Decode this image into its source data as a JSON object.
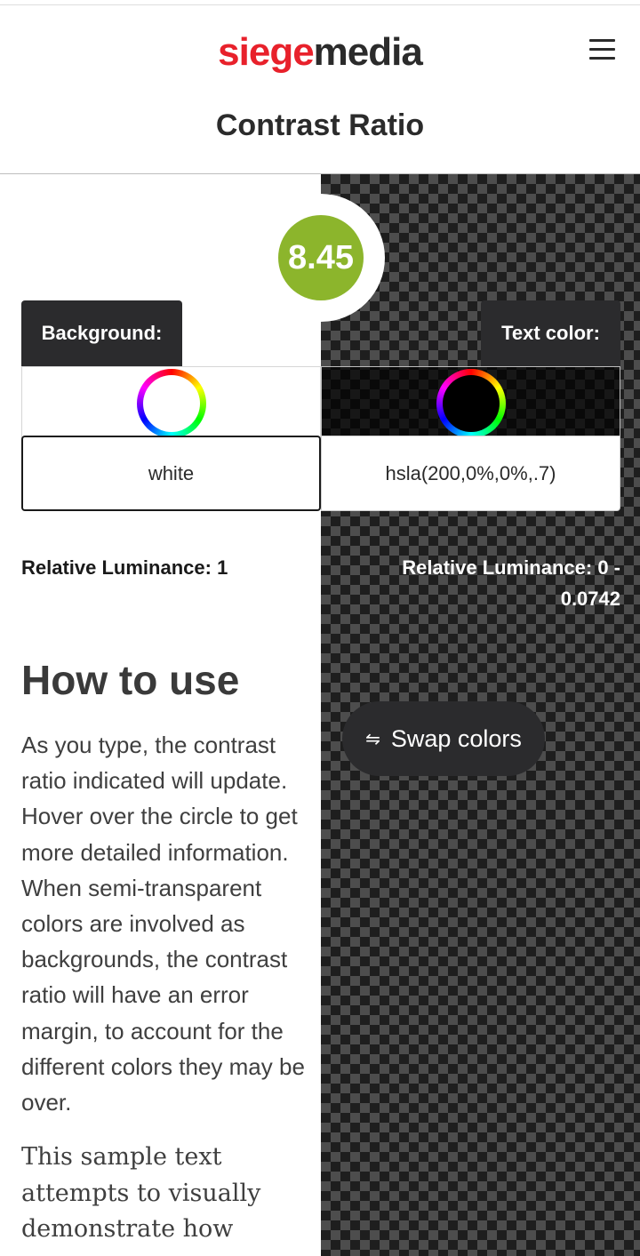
{
  "header": {
    "logo_part1": "siege",
    "logo_part2": "media",
    "menu_icon": "hamburger-menu-icon",
    "page_title": "Contrast Ratio"
  },
  "ratio": {
    "value": "8.45",
    "color": "#8cb52c"
  },
  "background": {
    "label": "Background:",
    "value": "white",
    "luminance": "Relative Luminance: 1"
  },
  "text_color": {
    "label": "Text color:",
    "value": "hsla(200,0%,0%,.7)",
    "luminance": "Relative Luminance: 0 - 0.0742"
  },
  "swap": {
    "icon": "⇋",
    "label": "Swap colors"
  },
  "how_to_use": {
    "title": "How to use",
    "body": "As you type, the contrast ratio indicated will update. Hover over the circle to get more detailed information. When semi-transparent colors are involved as backgrounds, the contrast ratio will have an error margin, to account for the different colors they may be over.",
    "sample": "This sample text attempts to visually demonstrate how"
  },
  "colors": {
    "brand_red": "#e8212b",
    "dark": "#2b2b2b",
    "ratio_green": "#8cb52c"
  }
}
